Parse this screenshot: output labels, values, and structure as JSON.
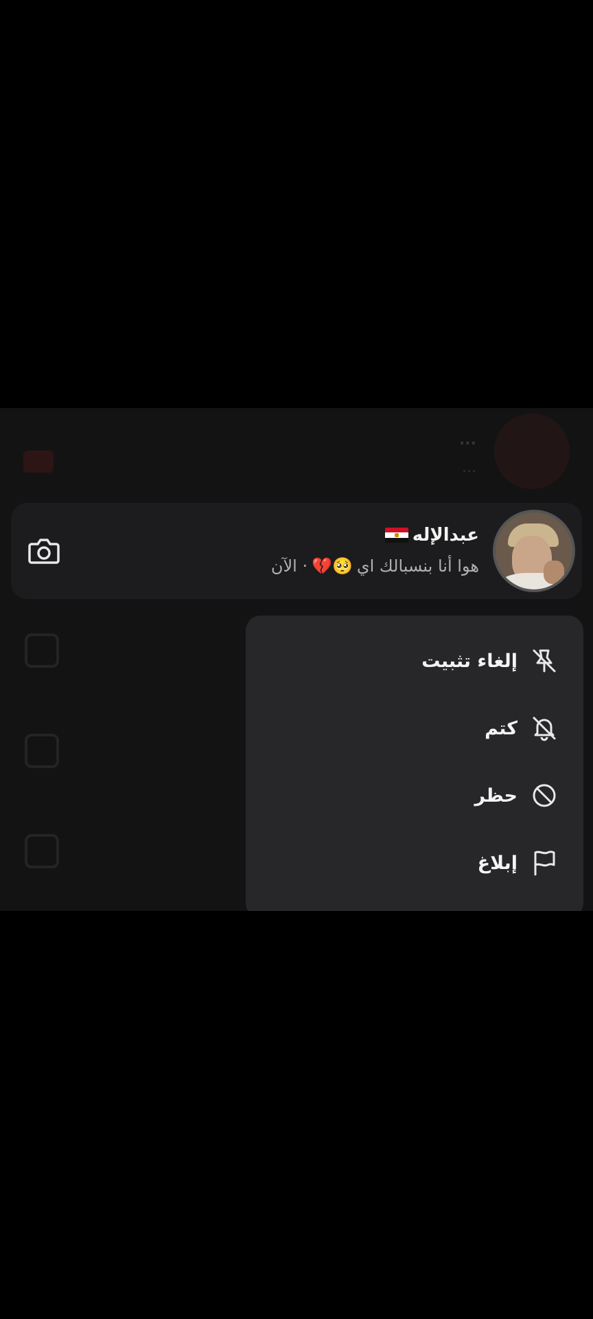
{
  "background_row": {
    "title": "...",
    "subtitle": "..."
  },
  "conversation": {
    "name": "عبدالإله",
    "flag_icon": "egypt-flag-icon",
    "preview_text": "هوا أنا بنسبالك اي",
    "preview_emoji": "🥺💔",
    "timestamp": "· الآن",
    "camera_icon": "camera-icon"
  },
  "menu": {
    "items": [
      {
        "label": "إلغاء تثبيت",
        "icon": "unpin-icon"
      },
      {
        "label": "كتم",
        "icon": "bell-off-icon"
      },
      {
        "label": "حظر",
        "icon": "block-icon"
      },
      {
        "label": "إبلاغ",
        "icon": "flag-icon"
      }
    ]
  },
  "colors": {
    "screen_bg": "#131314",
    "conversation_bg": "#1c1c1e",
    "menu_bg": "#27272a"
  }
}
